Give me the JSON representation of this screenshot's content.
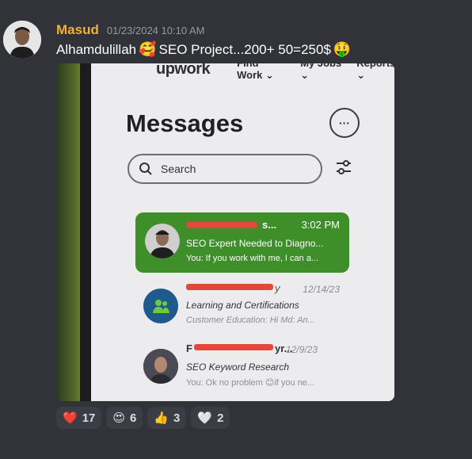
{
  "message": {
    "username": "Masud",
    "timestamp": "01/23/2024 10:10 AM",
    "text_before": "Alhamdulillah",
    "emoji_love": "🥰",
    "text_middle": "SEO Project...200+ 50=250$",
    "emoji_money": "🤑"
  },
  "screenshot": {
    "logo": "upwork",
    "nav": [
      "Find Work ⌄",
      "My Jobs ⌄",
      "Reports ⌄"
    ],
    "title": "Messages",
    "more_label": "···",
    "search_placeholder": "Search",
    "conversations": [
      {
        "name_suffix": "s...",
        "time": "3:02 PM",
        "subject": "SEO Expert Needed to Diagno...",
        "preview": "You: If you work with me, I can a..."
      },
      {
        "name_suffix": "y",
        "time": "12/14/23",
        "subject": "Learning and Certifications",
        "preview": "Customer Education: Hi Md: An..."
      },
      {
        "name_prefix": "F",
        "name_suffix": "yr...",
        "time": "12/9/23",
        "subject": "SEO Keyword Research",
        "preview": "You: Ok no problem 😊if you ne..."
      }
    ]
  },
  "reactions": [
    {
      "emoji": "❤️",
      "count": "17"
    },
    {
      "emoji": "😍",
      "count": "6"
    },
    {
      "emoji": "👍",
      "count": "3"
    },
    {
      "emoji": "🤍",
      "count": "2"
    }
  ]
}
